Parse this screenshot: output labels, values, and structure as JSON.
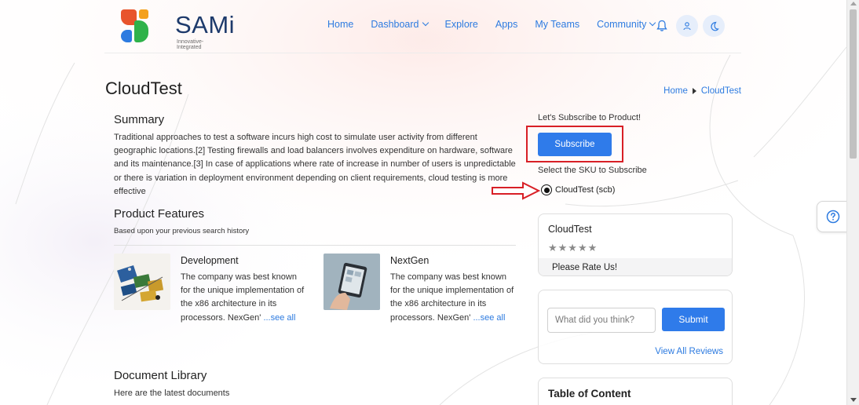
{
  "brand": {
    "name": "SAMi",
    "tagline": "Innovative-Integrated"
  },
  "nav": {
    "items": [
      {
        "label": "Home"
      },
      {
        "label": "Dashboard",
        "dropdown": true
      },
      {
        "label": "Explore"
      },
      {
        "label": "Apps"
      },
      {
        "label": "My Teams"
      },
      {
        "label": "Community",
        "dropdown": true
      }
    ],
    "icons": [
      "bell-icon",
      "user-icon",
      "moon-icon"
    ]
  },
  "page": {
    "title": "CloudTest",
    "breadcrumb": [
      "Home",
      "CloudTest"
    ]
  },
  "summary": {
    "heading": "Summary",
    "text": "Traditional approaches to test a software incurs high cost to simulate user activity from different geographic locations.[2] Testing firewalls and load balancers involves expenditure on hardware, software and its maintenance.[3] In case of applications where rate of increase in number of users is unpredictable or there is variation in deployment environment depending on client requirements, cloud testing is more effective"
  },
  "features": {
    "heading": "Product Features",
    "subtitle": "Based upon your previous search history",
    "cards": [
      {
        "title": "Development",
        "description": "The company was best known for the unique implementation of the x86 architecture in its processors. NexGen'",
        "more": "...see all"
      },
      {
        "title": "NextGen",
        "description": "The company was best known for the unique implementation of the x86 architecture in its processors. NexGen'",
        "more": "...see all"
      }
    ]
  },
  "doc_library": {
    "heading": "Document Library",
    "subtitle": "Here are the latest documents"
  },
  "subscribe": {
    "prompt": "Let's Subscribe to Product!",
    "button": "Subscribe",
    "sku_label": "Select the SKU to Subscribe",
    "sku_option": "CloudTest (scb)",
    "sku_selected": true
  },
  "rating": {
    "title": "CloudTest",
    "stars": "★★★★★",
    "rate_prompt": "Please Rate Us!"
  },
  "review": {
    "placeholder": "What did you think?",
    "submit": "Submit",
    "view_all": "View All Reviews"
  },
  "toc": {
    "title": "Table of Content"
  },
  "colors": {
    "accent": "#2f7bea",
    "annotation_red": "#d81f26"
  }
}
